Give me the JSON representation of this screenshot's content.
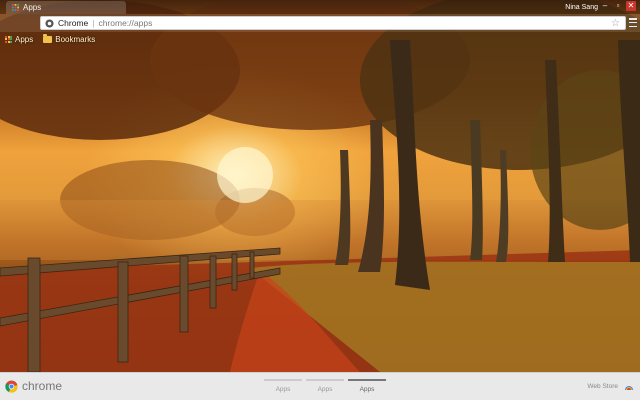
{
  "browser": {
    "tab_title": "Apps",
    "profile_name": "Nina Sang",
    "window_buttons": {
      "minimize": "–",
      "maximize": "▫",
      "close": "✕"
    }
  },
  "omnibox": {
    "site_label": "Chrome",
    "separator": "|",
    "url": "chrome://apps"
  },
  "bookmarks_bar": {
    "items": [
      {
        "label": "Apps",
        "icon": "apps-grid-icon"
      },
      {
        "label": "Bookmarks",
        "icon": "folder-icon"
      }
    ]
  },
  "footer": {
    "logo_text": "chrome",
    "pages": [
      {
        "label": "Apps",
        "active": false
      },
      {
        "label": "Apps",
        "active": false
      },
      {
        "label": "Apps",
        "active": true
      }
    ],
    "store_label": "Web Store"
  },
  "colors": {
    "close_button": "#c9372c",
    "footer_bg": "#e9e9e9",
    "omnibox_bg": "#ffffff"
  }
}
